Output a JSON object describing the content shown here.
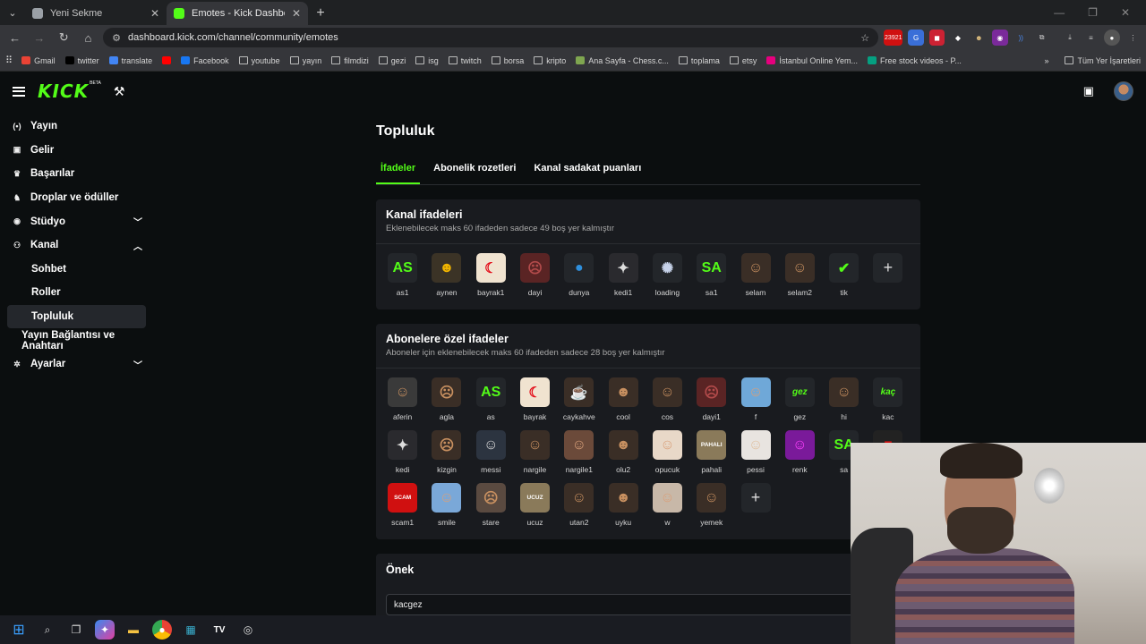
{
  "browser": {
    "tabs": [
      {
        "title": "Yeni Sekme",
        "active": false,
        "fav_color": "#9aa0a6"
      },
      {
        "title": "Emotes - Kick Dashboard",
        "active": true,
        "fav_color": "#53fc18"
      }
    ],
    "url": "dashboard.kick.com/channel/community/emotes",
    "ext_badge": "23921",
    "bookmarks": [
      {
        "label": "Gmail",
        "icon": "gmail-icon",
        "color": "#ea4335"
      },
      {
        "label": "twitter",
        "icon": "x-icon",
        "color": "#000000"
      },
      {
        "label": "translate",
        "icon": "translate-icon",
        "color": "#4285f4"
      },
      {
        "label": "",
        "icon": "youtube-icon",
        "color": "#ff0000"
      },
      {
        "label": "Facebook",
        "icon": "facebook-icon",
        "color": "#1877f2"
      },
      {
        "label": "youtube",
        "icon": "folder-icon"
      },
      {
        "label": "yayın",
        "icon": "folder-icon"
      },
      {
        "label": "filmdizi",
        "icon": "folder-icon"
      },
      {
        "label": "gezi",
        "icon": "folder-icon"
      },
      {
        "label": "isg",
        "icon": "folder-icon"
      },
      {
        "label": "twitch",
        "icon": "folder-icon"
      },
      {
        "label": "borsa",
        "icon": "folder-icon"
      },
      {
        "label": "kripto",
        "icon": "folder-icon"
      },
      {
        "label": "Ana Sayfa - Chess.c...",
        "icon": "chess-icon",
        "color": "#7fa650"
      },
      {
        "label": "toplama",
        "icon": "folder-icon"
      },
      {
        "label": "etsy",
        "icon": "folder-icon"
      },
      {
        "label": "İstanbul Online Yem...",
        "icon": "yemek-icon",
        "color": "#e6007e"
      },
      {
        "label": "Free stock videos - P...",
        "icon": "pexels-icon",
        "color": "#05a081"
      }
    ],
    "all_bookmarks": "Tüm Yer İşaretleri"
  },
  "header": {
    "logo": "KICK",
    "beta": "BETA"
  },
  "sidebar": {
    "items": [
      {
        "label": "Yayın",
        "icon": "broadcast-icon",
        "glyph": "(•)"
      },
      {
        "label": "Gelir",
        "icon": "revenue-icon",
        "glyph": "▣"
      },
      {
        "label": "Başarılar",
        "icon": "trophy-icon",
        "glyph": "♛"
      },
      {
        "label": "Droplar ve ödüller",
        "icon": "gift-icon",
        "glyph": "♞"
      },
      {
        "label": "Stüdyo",
        "icon": "studio-icon",
        "glyph": "◉",
        "chevron": "⌄"
      },
      {
        "label": "Kanal",
        "icon": "channel-icon",
        "glyph": "⚇",
        "chevron": "⌃"
      },
      {
        "label": "Sohbet",
        "sub": true
      },
      {
        "label": "Roller",
        "sub": true
      },
      {
        "label": "Topluluk",
        "sub": true,
        "active": true
      },
      {
        "label": "Yayın Bağlantısı ve Anahtarı",
        "sub": true,
        "indent_small": true
      },
      {
        "label": "Ayarlar",
        "icon": "settings-icon",
        "glyph": "✲",
        "chevron": "⌄"
      }
    ]
  },
  "main": {
    "title": "Topluluk",
    "tabs": [
      "İfadeler",
      "Abonelik rozetleri",
      "Kanal sadakat puanları"
    ],
    "channel_emotes": {
      "title": "Kanal ifadeleri",
      "subtitle": "Eklenebilecek maks 60 ifadeden sadece 49 boş yer kalmıştır",
      "items": [
        {
          "name": "as1",
          "glyph": "AS",
          "color": "#53fc18",
          "bg": "#23262a"
        },
        {
          "name": "aynen",
          "glyph": "☻",
          "color": "#f0b400",
          "bg": "#3b3326"
        },
        {
          "name": "bayrak1",
          "glyph": "☾",
          "color": "#e30a17",
          "bg": "#f0e3d0"
        },
        {
          "name": "dayi",
          "glyph": "☹",
          "color": "#b34b4b",
          "bg": "#5a2424"
        },
        {
          "name": "dunya",
          "glyph": "●",
          "color": "#2f8fdc",
          "bg": "#23262a"
        },
        {
          "name": "kedi1",
          "glyph": "✦",
          "color": "#dddddd",
          "bg": "#2a2a2e"
        },
        {
          "name": "loading",
          "glyph": "✺",
          "color": "#c7d3ea",
          "bg": "#23262a"
        },
        {
          "name": "sa1",
          "glyph": "SA",
          "color": "#53fc18",
          "bg": "#23262a"
        },
        {
          "name": "selam",
          "glyph": "☺",
          "color": "#c89060",
          "bg": "#3a2e26"
        },
        {
          "name": "selam2",
          "glyph": "☺",
          "color": "#c89060",
          "bg": "#3a2e26"
        },
        {
          "name": "tik",
          "glyph": "✔",
          "color": "#53fc18",
          "bg": "#23262a"
        },
        {
          "name": "",
          "glyph": "+",
          "color": "#dddddd",
          "bg": "#23262a",
          "add": true
        }
      ]
    },
    "sub_emotes": {
      "title": "Abonelere özel ifadeler",
      "subtitle": "Aboneler için eklenebilecek maks 60 ifadeden sadece 28 boş yer kalmıştır",
      "items": [
        {
          "name": "aferin",
          "glyph": "☺",
          "color": "#c89060",
          "bg": "#3a3a3a"
        },
        {
          "name": "agla",
          "glyph": "☹",
          "color": "#c89060",
          "bg": "#3a2e26"
        },
        {
          "name": "as",
          "glyph": "AS",
          "color": "#53fc18",
          "bg": "#23262a"
        },
        {
          "name": "bayrak",
          "glyph": "☾",
          "color": "#e30a17",
          "bg": "#f0e3d0"
        },
        {
          "name": "caykahve",
          "glyph": "☕",
          "color": "#c89060",
          "bg": "#3a2e26"
        },
        {
          "name": "cool",
          "glyph": "☻",
          "color": "#c89060",
          "bg": "#3a2e26"
        },
        {
          "name": "cos",
          "glyph": "☺",
          "color": "#c89060",
          "bg": "#3a2e26"
        },
        {
          "name": "dayi1",
          "glyph": "☹",
          "color": "#b34b4b",
          "bg": "#5a2424"
        },
        {
          "name": "f",
          "glyph": "☺",
          "color": "#d9a07a",
          "bg": "#6fa8d8"
        },
        {
          "name": "gez",
          "glyph": "gez",
          "color": "#53fc18",
          "bg": "#23262a"
        },
        {
          "name": "hi",
          "glyph": "☺",
          "color": "#c89060",
          "bg": "#3a2e26"
        },
        {
          "name": "kac",
          "glyph": "kaç",
          "color": "#53fc18",
          "bg": "#23262a"
        },
        {
          "name": "kedi",
          "glyph": "✦",
          "color": "#dddddd",
          "bg": "#2a2a2e"
        },
        {
          "name": "kizgin",
          "glyph": "☹",
          "color": "#c89060",
          "bg": "#3a2e26"
        },
        {
          "name": "messi",
          "glyph": "☺",
          "color": "#d9d9d9",
          "bg": "#2c3440"
        },
        {
          "name": "nargile",
          "glyph": "☺",
          "color": "#c89060",
          "bg": "#3a2e26"
        },
        {
          "name": "nargile1",
          "glyph": "☺",
          "color": "#d9a07a",
          "bg": "#6b4a3a"
        },
        {
          "name": "olu2",
          "glyph": "☻",
          "color": "#c89060",
          "bg": "#3a2e26"
        },
        {
          "name": "opucuk",
          "glyph": "☺",
          "color": "#d9a07a",
          "bg": "#e8d8c8"
        },
        {
          "name": "pahali",
          "glyph": "PAHALI",
          "color": "#ffffff",
          "bg": "#8a7a5a"
        },
        {
          "name": "pessi",
          "glyph": "☺",
          "color": "#e0c0a0",
          "bg": "#e8e4e0"
        },
        {
          "name": "renk",
          "glyph": "☺",
          "color": "#ff40ff",
          "bg": "#7a1a9a"
        },
        {
          "name": "sa",
          "glyph": "SA",
          "color": "#53fc18",
          "bg": "#23262a"
        },
        {
          "name": "",
          "glyph": "■",
          "color": "#d01010",
          "bg": "#222222"
        },
        {
          "name": "scam1",
          "glyph": "SCAM",
          "color": "#ffffff",
          "bg": "#d01010"
        },
        {
          "name": "smile",
          "glyph": "☺",
          "color": "#d9a07a",
          "bg": "#7aa8d8"
        },
        {
          "name": "stare",
          "glyph": "☹",
          "color": "#c89060",
          "bg": "#5a4a40"
        },
        {
          "name": "ucuz",
          "glyph": "UCUZ",
          "color": "#ffffff",
          "bg": "#8a7a5a"
        },
        {
          "name": "utan2",
          "glyph": "☺",
          "color": "#c89060",
          "bg": "#3a2e26"
        },
        {
          "name": "uyku",
          "glyph": "☻",
          "color": "#c89060",
          "bg": "#3a2e26"
        },
        {
          "name": "w",
          "glyph": "☺",
          "color": "#d9a07a",
          "bg": "#c8b8a8"
        },
        {
          "name": "yemek",
          "glyph": "☺",
          "color": "#c89060",
          "bg": "#3a2e26"
        },
        {
          "name": "",
          "glyph": "+",
          "color": "#dddddd",
          "bg": "#23262a",
          "add": true
        }
      ]
    },
    "prefix": {
      "title": "Önek",
      "value": "kacgez"
    }
  },
  "colors": {
    "accent": "#53fc18",
    "background": "#0b0e0f",
    "card": "#191b1f"
  }
}
